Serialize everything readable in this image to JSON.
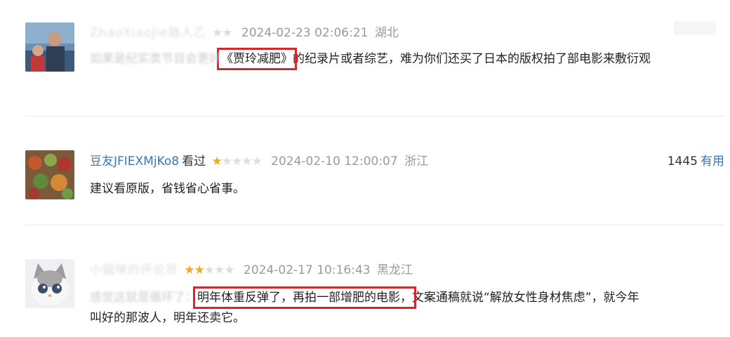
{
  "comments": [
    {
      "username": "ZhaoXiaoJie路人乙",
      "watched": "",
      "stars_on": 0,
      "stars_total": 5,
      "time": "2024-02-23 02:06:21",
      "location": "湖北",
      "text_prefix": "如果是纪实类节目会更好",
      "highlight": "《贾玲减肥》",
      "text_suffix": "的纪录片或者综艺，难为你们还买了日本的版权拍了部电影来敷衍观",
      "useful_count": "",
      "useful_label": ""
    },
    {
      "username": "豆友JFIEXMjKo8",
      "watched": "看过",
      "stars_on": 1,
      "stars_total": 5,
      "time": "2024-02-10 12:00:07",
      "location": "浙江",
      "text": "建议看原版，省钱省心省事。",
      "useful_count": "1445",
      "useful_label": "有用"
    },
    {
      "username": "小猫咪的评论员",
      "watched": "",
      "stars_on": 2,
      "stars_total": 5,
      "time": "2024-02-17 10:16:43",
      "location": "黑龙江",
      "text_prefix": "感觉这就是循环了：",
      "highlight": "明年体重反弹了，再拍一部增肥的电影，",
      "text_suffix": "文案通稿就说“解放女性身材焦虑”，就今年",
      "text_line2": "叫好的那波人，明年还卖它。",
      "useful_count": "",
      "useful_label": ""
    }
  ],
  "colors": {
    "link": "#3a77b5",
    "star": "#f5a623",
    "highlight_box": "#d7262c"
  }
}
